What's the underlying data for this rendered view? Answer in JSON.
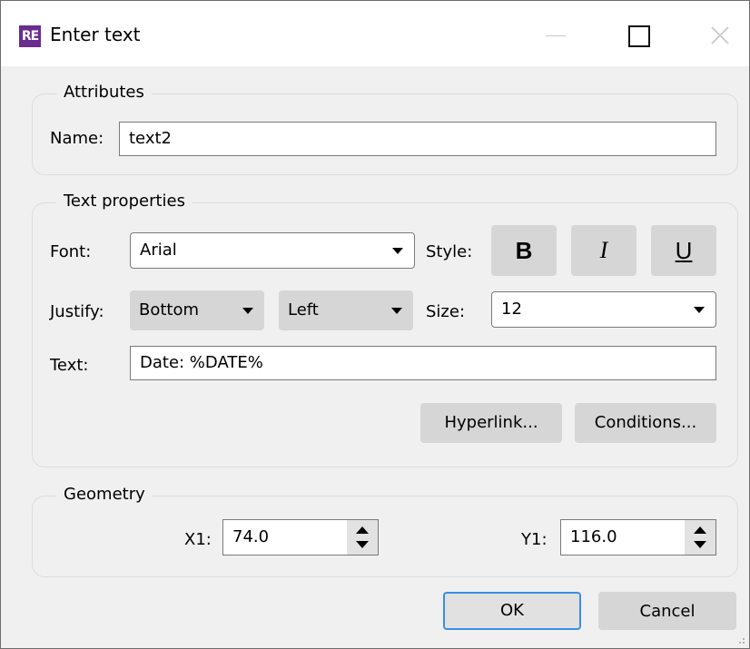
{
  "window": {
    "app_icon": "RE",
    "title": "Enter text"
  },
  "attributes": {
    "group_title": "Attributes",
    "name_label": "Name:",
    "name_value": "text2"
  },
  "text_properties": {
    "group_title": "Text properties",
    "font_label": "Font:",
    "font_value": "Arial",
    "style_label": "Style:",
    "bold_label": "B",
    "italic_label": "I",
    "underline_label": "U",
    "justify_label": "Justify:",
    "justify_vertical": "Bottom",
    "justify_horizontal": "Left",
    "size_label": "Size:",
    "size_value": "12",
    "text_label": "Text:",
    "text_value": "Date: %DATE%",
    "hyperlink_label": "Hyperlink...",
    "conditions_label": "Conditions..."
  },
  "geometry": {
    "group_title": "Geometry",
    "x1_label": "X1:",
    "x1_value": "74.0",
    "y1_label": "Y1:",
    "y1_value": "116.0"
  },
  "buttons": {
    "ok_label": "OK",
    "cancel_label": "Cancel"
  },
  "colors": {
    "app_icon_bg": "#6b2c8f",
    "ok_focus_border": "#3a8ee6"
  }
}
